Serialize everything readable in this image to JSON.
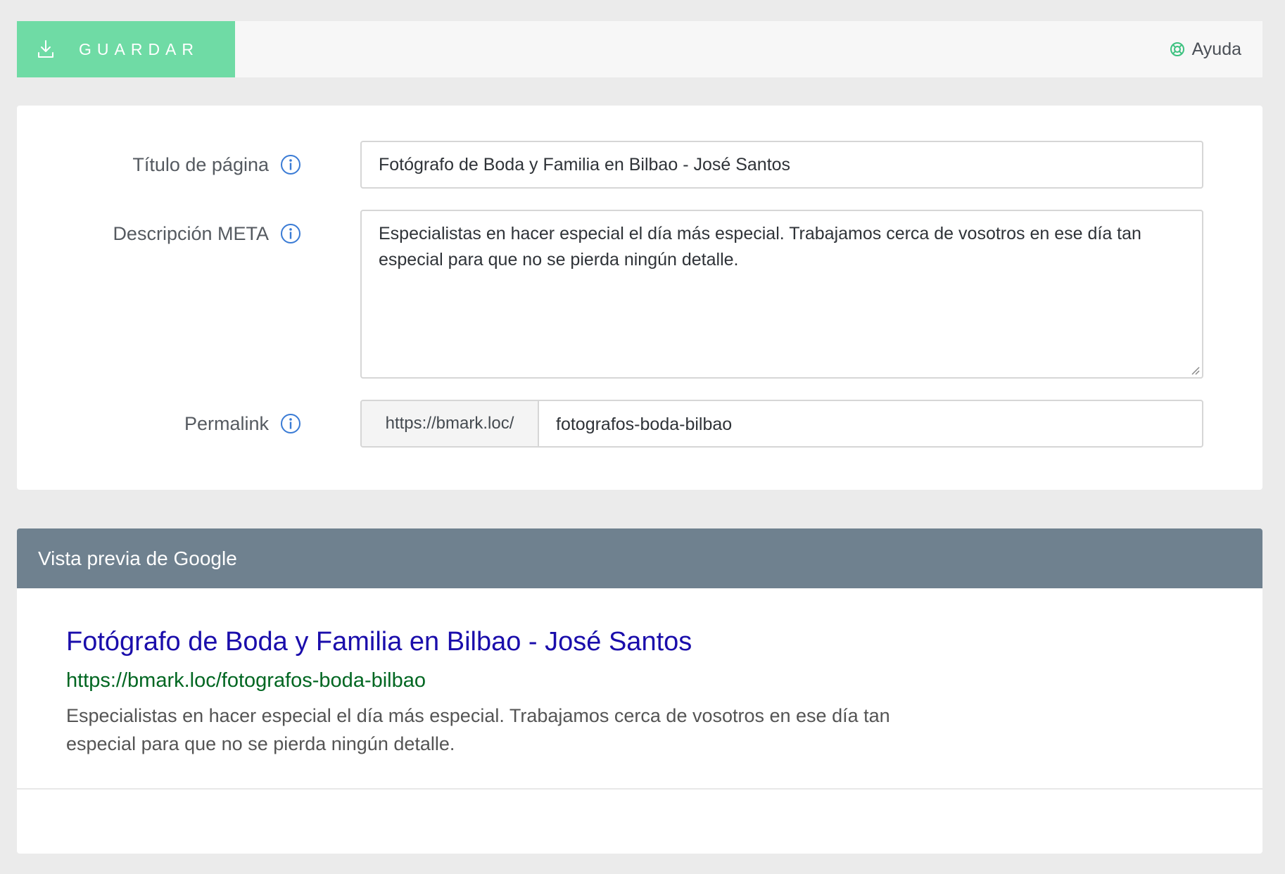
{
  "toolbar": {
    "save_label": "GUARDAR",
    "save_icon": "download-icon",
    "help_label": "Ayuda",
    "help_icon": "lifebuoy-icon"
  },
  "form": {
    "page_title": {
      "label": "Título de página",
      "value": "Fotógrafo de Boda y Familia en Bilbao - José Santos"
    },
    "meta_description": {
      "label": "Descripción META",
      "value": "Especialistas en hacer especial el día más especial. Trabajamos cerca de vosotros en ese día tan especial para que no se pierda ningún detalle."
    },
    "permalink": {
      "label": "Permalink",
      "prefix": "https://bmark.loc/",
      "value": "fotografos-boda-bilbao"
    }
  },
  "preview": {
    "header": "Vista previa de Google",
    "title": "Fotógrafo de Boda y Familia en Bilbao - José Santos",
    "url": "https://bmark.loc/fotografos-boda-bilbao",
    "description": "Especialistas en hacer especial el día más especial. Trabajamos cerca de vosotros en ese día tan especial para que no se pierda ningún detalle."
  },
  "colors": {
    "save_button": "#6fdba5",
    "preview_header": "#6f818f",
    "serp_title": "#1a0dab",
    "serp_url": "#006621",
    "info_icon": "#3a7bd5",
    "help_icon": "#3cc17f"
  }
}
